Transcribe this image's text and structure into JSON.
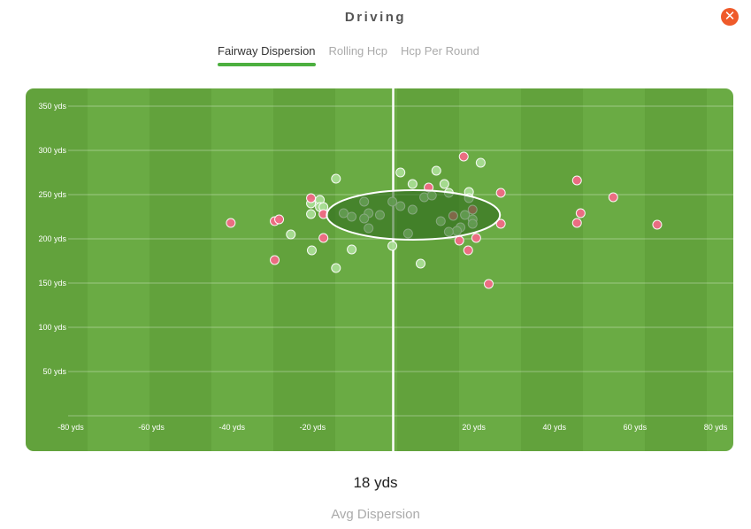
{
  "header": {
    "title": "Driving",
    "close_icon": "close-icon"
  },
  "tabs": [
    {
      "label": "Fairway Dispersion",
      "active": true
    },
    {
      "label": "Rolling Hcp",
      "active": false
    },
    {
      "label": "Hcp Per Round",
      "active": false
    }
  ],
  "colors": {
    "fairway_light": "#6aab44",
    "fairway_dark": "#62a23c",
    "hit": "#a8dd93",
    "miss": "#f26b86",
    "accent": "#4caf3f",
    "close": "#ef5a2a"
  },
  "chart_data": {
    "type": "scatter",
    "xlim": [
      -80,
      80
    ],
    "ylim": [
      0,
      350
    ],
    "x_ticks": [
      {
        "v": -80,
        "label": "-80 yds"
      },
      {
        "v": -60,
        "label": "-60 yds"
      },
      {
        "v": -40,
        "label": "-40 yds"
      },
      {
        "v": -20,
        "label": "-20 yds"
      },
      {
        "v": 20,
        "label": "20 yds"
      },
      {
        "v": 40,
        "label": "40 yds"
      },
      {
        "v": 60,
        "label": "60 yds"
      },
      {
        "v": 80,
        "label": "80 yds"
      }
    ],
    "y_ticks": [
      {
        "v": 50,
        "label": "50 yds"
      },
      {
        "v": 100,
        "label": "100 yds"
      },
      {
        "v": 150,
        "label": "150 yds"
      },
      {
        "v": 200,
        "label": "200 yds"
      },
      {
        "v": 250,
        "label": "250 yds"
      },
      {
        "v": 300,
        "label": "300 yds"
      },
      {
        "v": 350,
        "label": "350 yds"
      }
    ],
    "grid": true,
    "dispersion_ellipse": {
      "cx": 5,
      "cy": 227,
      "rx": 21.5,
      "ry": 28
    },
    "series": [
      {
        "kind": "fairway",
        "points": [
          [
            -18.2,
            244
          ],
          [
            -20.4,
            240
          ],
          [
            -18.2,
            236
          ],
          [
            -17.3,
            236
          ],
          [
            -20.4,
            228
          ],
          [
            -12.3,
            229
          ],
          [
            -10.3,
            225
          ],
          [
            -7.2,
            242
          ],
          [
            -6.1,
            229
          ],
          [
            -7.2,
            223
          ],
          [
            -3.3,
            227
          ],
          [
            -6.1,
            212
          ],
          [
            -0.2,
            242
          ],
          [
            -25.4,
            205
          ],
          [
            -20.2,
            187
          ],
          [
            -10.3,
            188
          ],
          [
            -14.2,
            167
          ],
          [
            -0.2,
            192
          ],
          [
            -14.2,
            268
          ],
          [
            1.8,
            237
          ],
          [
            4.8,
            233
          ],
          [
            4.8,
            262
          ],
          [
            10.7,
            277
          ],
          [
            1.8,
            275
          ],
          [
            21.7,
            286
          ],
          [
            7.7,
            247
          ],
          [
            9.6,
            249
          ],
          [
            12.7,
            262
          ],
          [
            13.8,
            252
          ],
          [
            18.8,
            253
          ],
          [
            18.8,
            246
          ],
          [
            11.8,
            220
          ],
          [
            17.8,
            227
          ],
          [
            19.7,
            222
          ],
          [
            19.7,
            217
          ],
          [
            16.7,
            213
          ],
          [
            15.8,
            209
          ],
          [
            13.8,
            208
          ],
          [
            3.7,
            206
          ],
          [
            6.8,
            172
          ]
        ]
      },
      {
        "kind": "miss",
        "points": [
          [
            -40.3,
            218
          ],
          [
            -29.4,
            220
          ],
          [
            -28.3,
            222
          ],
          [
            -29.4,
            176
          ],
          [
            -20.4,
            246
          ],
          [
            -17.3,
            228
          ],
          [
            -17.3,
            201
          ],
          [
            8.8,
            258
          ],
          [
            17.5,
            293
          ],
          [
            14.9,
            226
          ],
          [
            19.7,
            233
          ],
          [
            16.4,
            198
          ],
          [
            20.6,
            201
          ],
          [
            18.6,
            187
          ],
          [
            23.7,
            149
          ],
          [
            26.7,
            252
          ],
          [
            26.7,
            217
          ],
          [
            45.6,
            266
          ],
          [
            46.5,
            229
          ],
          [
            45.6,
            218
          ],
          [
            54.6,
            247
          ],
          [
            65.5,
            216
          ]
        ]
      }
    ]
  },
  "summary": {
    "value": "18 yds",
    "label": "Avg Dispersion"
  }
}
